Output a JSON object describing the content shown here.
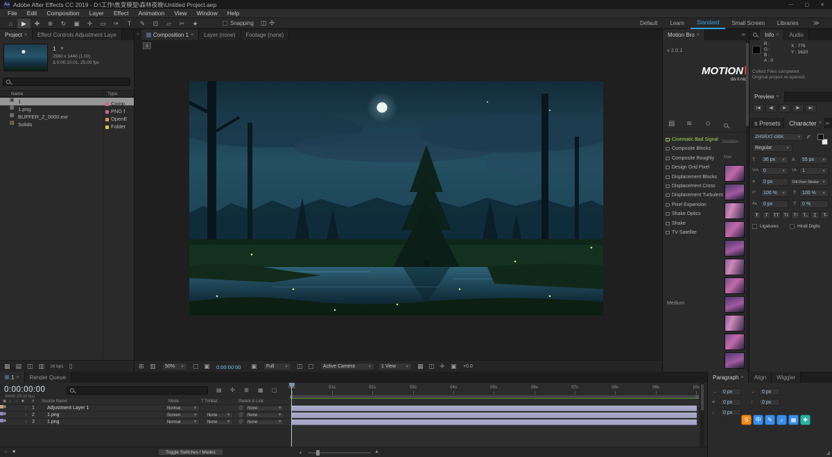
{
  "glyphs": {
    "menu": "≡",
    "dropdown": "▼",
    "overflow": "»",
    "chevrons": "≫",
    "twirl": "›",
    "eye": "◉",
    "audio": "♪",
    "solo": "○",
    "lock": "■",
    "at": "@",
    "camera": "▣",
    "trash": "▯",
    "grip": "◢",
    "zoom_out": "▴",
    "zoom_in": "▲",
    "min": "—",
    "max": "▢",
    "close": "✕"
  },
  "titlebar": {
    "app_badge": "Ae",
    "title": "Adobe After Effects CC 2019 - D:\\工作\\焦变模型\\森林夜晚\\Untitled Project.aep"
  },
  "menubar": {
    "items": [
      "File",
      "Edit",
      "Composition",
      "Layer",
      "Effect",
      "Animation",
      "View",
      "Window",
      "Help"
    ]
  },
  "toolbar": {
    "tools": [
      {
        "glyph": "⌂"
      },
      {
        "glyph": "▶"
      },
      {
        "glyph": "✚"
      },
      {
        "glyph": "⊕"
      },
      {
        "glyph": "↻"
      },
      {
        "glyph": "▣"
      },
      {
        "glyph": "✛"
      },
      {
        "glyph": "▭"
      },
      {
        "glyph": "✑"
      },
      {
        "glyph": "T"
      },
      {
        "glyph": "✎"
      },
      {
        "glyph": "⊡"
      },
      {
        "glyph": "▱"
      },
      {
        "glyph": "✂"
      },
      {
        "glyph": "★"
      }
    ],
    "snapping_label": "Snapping",
    "snap_icons": [
      "◫",
      "✣"
    ],
    "workspaces": [
      "Default",
      "Learn",
      "Standard",
      "Small Screen",
      "Libraries"
    ]
  },
  "project": {
    "tabs": [
      "Project",
      "Effect Controls Adjustment Laye"
    ],
    "comp_title": "1",
    "comp_line1": "2560 x 1440 (1.00)",
    "comp_line2": "Δ 0:00:10:01, 25.00 fps",
    "columns": {
      "name": "Name",
      "type": "Type"
    },
    "items": [
      {
        "icon": "▣",
        "name": "1",
        "type": "Comp",
        "chip_style": "background:#d4608c"
      },
      {
        "icon": "▦",
        "name": "1.png",
        "type": "PNG f",
        "chip_style": "background:#d4608c"
      },
      {
        "icon": "▦",
        "name": "BUFFER_Z_0000.exr",
        "type": "OpenE",
        "chip_style": "background:#d99a4e"
      },
      {
        "icon": "▤",
        "name": "Solids",
        "type": "Folder",
        "chip_style": "background:#d9c94e"
      }
    ],
    "footer_icons": [
      "▦",
      "▤",
      "◫",
      "▥"
    ],
    "bpc_label": "16 bpc"
  },
  "comp": {
    "tabs": [
      "Composition 1",
      "Layer  (none)",
      "Footage  (none)"
    ],
    "mini_tag": "1",
    "bottom": {
      "icons_a": [
        "⊞",
        "▥"
      ],
      "zoom": "50%",
      "icons_b": [
        "▢",
        "▣"
      ],
      "timecode": "0:00:00:00",
      "resolution": "Full",
      "icons_c": [
        "◫",
        "▢"
      ],
      "camera": "Active Camera",
      "views": "1 View",
      "icons_d": [
        "▦",
        "◫",
        "✛",
        "▣"
      ],
      "exposure": "+0.0"
    }
  },
  "motion_bro": {
    "tab": "Motion Bro",
    "version": "v 2.0.1",
    "logo": "MOTION",
    "logo_sub": "do it nice",
    "toolbar_icons": [
      "▤",
      "≋",
      "☺"
    ],
    "duration_label": "Duration",
    "max_label": "Max",
    "presets": [
      "Cinematic Bad Signal",
      "Composite Blocks",
      "Composite Roughly",
      "Design Grid Pixel",
      "Displacement Blocks",
      "Displacement Cross",
      "Displacement Turbulent",
      "Pixel Expansion",
      "Shake Optics",
      "Shake",
      "TV Satellite"
    ],
    "medium_label": "Medium"
  },
  "info": {
    "tabs": [
      "Info",
      "Audio"
    ],
    "r": "R :",
    "g": "G :",
    "b": "B :",
    "a": "A : 0",
    "x": "X : 776",
    "y": "Y : 1620",
    "status1": "Collect Files completed.",
    "status2": "Original project re-opened."
  },
  "preview": {
    "title": "Preview",
    "buttons": [
      "|◀",
      "◀|",
      "▶",
      "|▶",
      "▶|"
    ]
  },
  "character": {
    "left_tab": "s Presets",
    "tab": "Character",
    "font_family": "ZHSRXT-GBK",
    "font_style": "Regular",
    "labels": {
      "size": "T",
      "leading": "A",
      "kerning": "V/A",
      "tracking": "VA",
      "stroke": "≡",
      "vscale": "IT",
      "hscale": "T",
      "baseline": "Aa",
      "tsume": "T"
    },
    "font_size": "36 px",
    "leading": "55 px",
    "kerning": "0",
    "tracking": "1",
    "stroke_width": "0 px",
    "stroke_mode": "Fill Over Stroke",
    "v_scale": "100 %",
    "h_scale": "100 %",
    "baseline_shift": "0 px",
    "tsume": "0 %",
    "style_buttons": [
      "T",
      "T",
      "TT",
      "Tt",
      "T¹",
      "T₁",
      "T̲",
      "T̶"
    ],
    "ligatures": "Ligatures",
    "hindi": "Hindi Digits"
  },
  "timeline": {
    "tab_comp": "1",
    "tab_rq": "Render Queue",
    "timecode": "0:00:00:00",
    "sub_timecode": "00000 (25.00 fps)",
    "toolbar_icons": [
      "▤",
      "✣",
      "⊞",
      "▦",
      "▢"
    ],
    "cols": {
      "num": "#",
      "source": "Source Name",
      "mode": "Mode",
      "trkmat": "T TrkMat",
      "parent": "Parent & Link"
    },
    "layers": [
      {
        "num": "1",
        "name": "Adjustment Layer 1",
        "mode": "Normal",
        "parent": "None",
        "chip_style": "background:#c9a07f"
      },
      {
        "num": "2",
        "name": "1.png",
        "mode": "Screen",
        "trkmat": "None",
        "parent": "None",
        "chip_style": "background:#938bc4"
      },
      {
        "num": "3",
        "name": "1.png",
        "mode": "Normal",
        "trkmat": "None",
        "parent": "None",
        "chip_style": "background:#938bc4"
      }
    ],
    "ruler": [
      "00s",
      "01s",
      "02s",
      "03s",
      "04s",
      "05s",
      "06s",
      "07s",
      "08s",
      "09s",
      "10s"
    ],
    "toggle_label": "Toggle Switches / Modes"
  },
  "paragraph": {
    "tabs": [
      "Paragraph",
      "Align",
      "Wiggler"
    ],
    "field_icons": [
      "→",
      "←",
      "≡",
      "↑",
      "↓"
    ],
    "fields": [
      "0 px",
      "0 px",
      "0 px",
      "0 px",
      "0 px"
    ]
  },
  "ime": {
    "icons": [
      {
        "glyph": "S",
        "style": "background:#f08a1d;color:#fff"
      },
      {
        "glyph": "中",
        "style": "background:#3a8ee6;color:#fff"
      },
      {
        "glyph": "✎",
        "style": "background:#3a8ee6;color:#fff"
      },
      {
        "glyph": "♪",
        "style": "background:#3a8ee6;color:#fff"
      },
      {
        "glyph": "▦",
        "style": "background:#3a8ee6;color:#fff"
      },
      {
        "glyph": "✚",
        "style": "background:#28b5a0;color:#fff"
      }
    ]
  }
}
